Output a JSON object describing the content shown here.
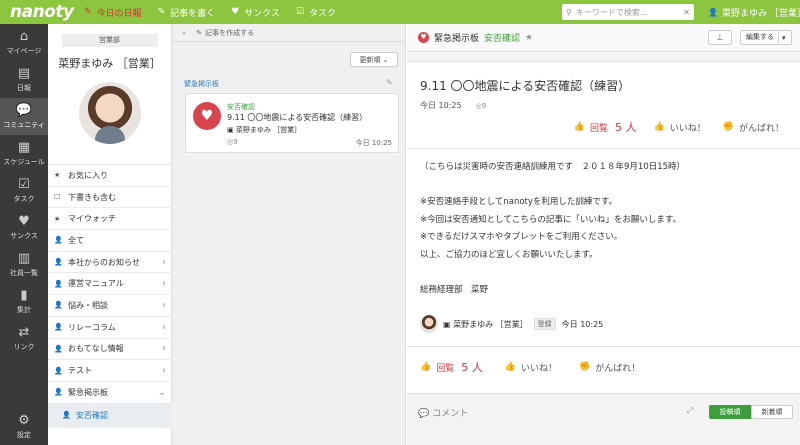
{
  "app": {
    "logo": "nanoty"
  },
  "topnav": {
    "items": [
      {
        "icon": "✎",
        "label": "今日の日報"
      },
      {
        "icon": "✎",
        "label": "記事を書く"
      },
      {
        "icon": "♥",
        "label": "サンクス"
      },
      {
        "icon": "☑",
        "label": "タスク"
      }
    ],
    "search_placeholder": "キーワードで検索...",
    "search_clear": "✕",
    "user_icon": "👤",
    "user": "菜野まゆみ ［営業］"
  },
  "leftnav": {
    "items": [
      {
        "icon": "⌂",
        "label": "マイページ"
      },
      {
        "icon": "▤",
        "label": "日報"
      },
      {
        "icon": "💬",
        "label": "コミュニティ"
      },
      {
        "icon": "▦",
        "label": "スケジュール"
      },
      {
        "icon": "☑",
        "label": "タスク"
      },
      {
        "icon": "♥",
        "label": "サンクス"
      },
      {
        "icon": "▥",
        "label": "社員一覧"
      },
      {
        "icon": "▮",
        "label": "集計"
      },
      {
        "icon": "⇄",
        "label": "リンク"
      }
    ],
    "settings": {
      "icon": "⚙",
      "label": "設定"
    }
  },
  "sidebar": {
    "dept": "営業部",
    "name": "菜野まゆみ ［営業］",
    "items": [
      {
        "icon": "★",
        "label": "お気に入り",
        "chev": ""
      },
      {
        "icon": "☐",
        "label": "下書きも含む",
        "chev": ""
      },
      {
        "icon": "★",
        "label": "マイウォッチ",
        "chev": ""
      },
      {
        "icon": "👤",
        "label": "全て",
        "chev": ""
      },
      {
        "icon": "👤",
        "label": "本社からのお知らせ",
        "chev": "‹"
      },
      {
        "icon": "👤",
        "label": "運営マニュアル",
        "chev": "‹"
      },
      {
        "icon": "👤",
        "label": "悩み・相談",
        "chev": "‹"
      },
      {
        "icon": "👤",
        "label": "リレーコラム",
        "chev": "‹"
      },
      {
        "icon": "👤",
        "label": "おもてなし情報",
        "chev": "‹"
      },
      {
        "icon": "👤",
        "label": "テスト",
        "chev": "‹"
      },
      {
        "icon": "👤",
        "label": "緊急掲示板",
        "chev": "⌄"
      }
    ],
    "sub_item": {
      "icon": "👤",
      "label": "安否確認"
    }
  },
  "list": {
    "collapse": "«",
    "create_icon": "✎",
    "create_label": "記事を作成する",
    "sort": "更新順 ⌄",
    "category": "緊急掲示板",
    "card": {
      "icon": "♥",
      "tag": "安否確認",
      "title": "9.11 〇〇地震による安否確認（練習）",
      "author": "▣ 菜野まゆみ ［営業］",
      "views": "◎9",
      "time": "今日 10:25"
    }
  },
  "article": {
    "board": "緊急掲示板",
    "tag": "安否確認",
    "star": "★",
    "pin": "⊥",
    "edit": "編集する",
    "edit_caret": "▾",
    "title": "9.11 〇〇地震による安否確認（練習）",
    "time": "今日 10:25",
    "views": "◎9",
    "reactions": {
      "answer_icon": "👍",
      "answer_label": "回覧",
      "answer_count": "5 人",
      "like_icon": "👍",
      "like": "いいね！",
      "cheer_icon": "✊",
      "cheer": "がんばれ！"
    },
    "body": "（こちらは災害時の安否連絡訓練用です　２０１８年9月10日15時）\n\n※安否連絡手段としてnanotyを利用した訓練です。\n※今回は安否通知としてこちらの記事に「いいね」をお願いします。\n※できるだけスマホやタブレットをご利用ください。\n以上、ご協力のほど宜しくお願いいたします。\n\n総務経理部　菜野",
    "signer": {
      "name": "▣ 菜野まゆみ ［営業］",
      "badge": "登録",
      "time": "今日 10:25"
    },
    "comment_icon": "💬",
    "comment_label": "コメント",
    "comment_expand": "⤢",
    "tab_posted": "投稿順",
    "tab_new": "新着順"
  }
}
